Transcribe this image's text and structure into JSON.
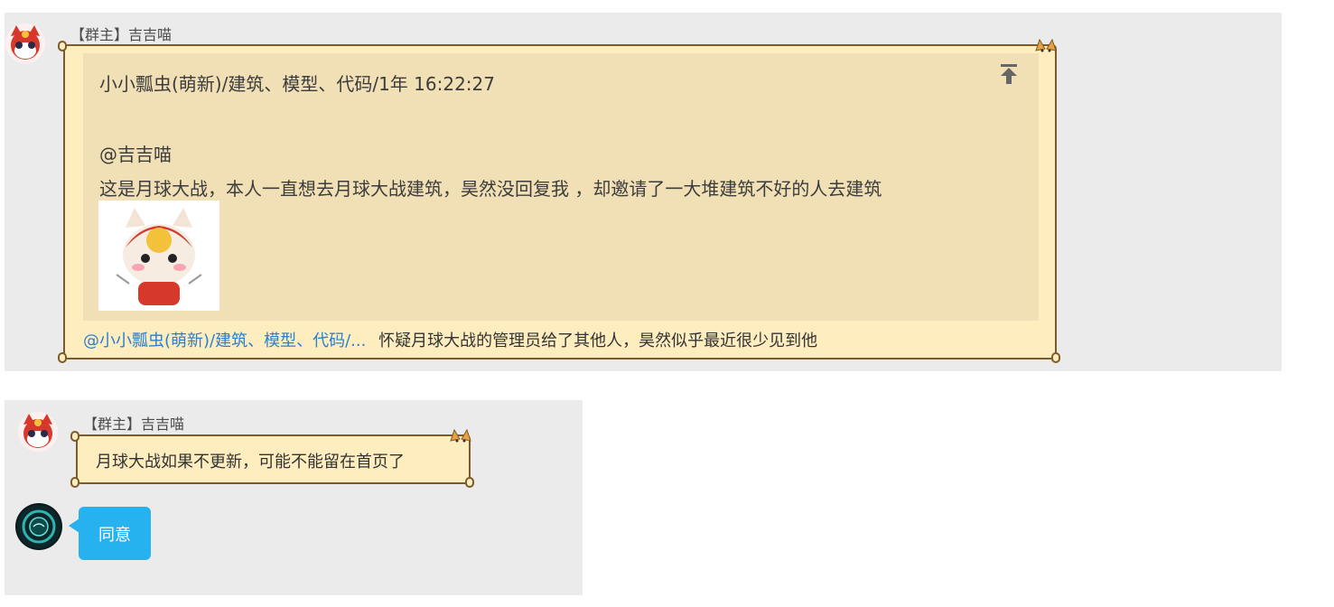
{
  "messages": [
    {
      "sender": "【群主】吉吉喵",
      "quote": {
        "header": "小小瓢虫(萌新)/建筑、模型、代码/1年   16:22:27",
        "mention": "@吉吉喵",
        "body": " 这是月球大战，本人一直想去月球大战建筑，昊然没回复我 ，却邀请了一大堆建筑不好的人去建筑",
        "sticker": "cat-mascot-sticker"
      },
      "reply_mention": "@小小瓢虫(萌新)/建筑、模型、代码/...",
      "reply_text": "怀疑月球大战的管理员给了其他人，昊然似乎最近很少见到他"
    },
    {
      "sender": "【群主】吉吉喵",
      "text": "月球大战如果不更新，可能不能留在首页了"
    },
    {
      "text": "同意"
    }
  ],
  "colors": {
    "panel_bg": "#ebebeb",
    "scroll_bg": "#fdedbf",
    "scroll_border": "#7d5a2a",
    "quote_bg": "#f1e0b5",
    "mention": "#2b7fd0",
    "self_bubble": "#26b1ef"
  },
  "icons": [
    "avatar-cat",
    "scroll-top-icon",
    "avatar-dark-circle"
  ]
}
